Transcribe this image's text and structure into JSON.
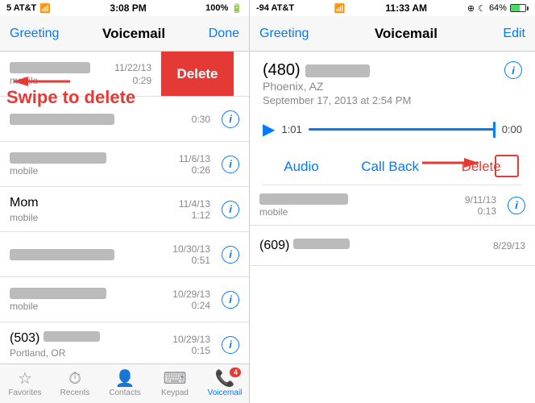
{
  "left": {
    "status": {
      "carrier": "5 AT&T",
      "signal": "▪▪▪▪▪",
      "wifi": "WiFi",
      "time": "3:08 PM",
      "battery_pct": "100%"
    },
    "nav": {
      "greeting": "Greeting",
      "title": "Voicemail",
      "done": "Done"
    },
    "swipe_label": "Swipe to delete",
    "delete_btn": "Delete",
    "items": [
      {
        "name": "blurred",
        "sub": "mobile",
        "date": "11/22/13",
        "dur": "0:29",
        "swiped": true
      },
      {
        "name": "blurred",
        "sub": "",
        "date": "",
        "dur": "0:30",
        "swiped": false
      },
      {
        "name": "blurred",
        "sub": "mobile",
        "date": "11/6/13",
        "dur": "0:26",
        "swiped": false
      },
      {
        "name": "Mom",
        "sub": "mobile",
        "date": "11/4/13",
        "dur": "1:12",
        "swiped": false
      },
      {
        "name": "blurred",
        "sub": "",
        "date": "10/30/13",
        "dur": "0:51",
        "swiped": false
      },
      {
        "name": "blurred",
        "sub": "mobile",
        "date": "10/29/13",
        "dur": "0:24",
        "swiped": false
      },
      {
        "name": "(503) blurred",
        "sub": "Portland, OR",
        "date": "10/29/13",
        "dur": "0:15",
        "swiped": false
      }
    ],
    "tabs": [
      {
        "icon": "★",
        "label": "Favorites",
        "badge": null,
        "active": false
      },
      {
        "icon": "⏱",
        "label": "Recents",
        "badge": null,
        "active": false
      },
      {
        "icon": "👤",
        "label": "Contacts",
        "badge": null,
        "active": false
      },
      {
        "icon": "⌨",
        "label": "Keypad",
        "badge": null,
        "active": false
      },
      {
        "icon": "📞",
        "label": "Voicemail",
        "badge": "4",
        "active": true
      }
    ]
  },
  "right": {
    "status": {
      "carrier": "-94 AT&T",
      "wifi": "WiFi",
      "time": "11:33 AM",
      "icons": "⊕ ☾",
      "battery_pct": "64%"
    },
    "nav": {
      "greeting": "Greeting",
      "title": "Voicemail",
      "edit": "Edit"
    },
    "detail": {
      "number": "(480)",
      "number_blurred": true,
      "location": "Phoenix, AZ",
      "date": "September 17, 2013 at 2:54 PM",
      "scrubber_pos": "1:01",
      "scrubber_end": "0:00"
    },
    "actions": {
      "audio": "Audio",
      "callback": "Call Back",
      "delete": "Delete"
    },
    "bottom_items": [
      {
        "sub": "mobile",
        "date": "9/11/13",
        "dur": "0:13"
      },
      {
        "name": "(609)",
        "date": "8/29/13",
        "dur": ""
      }
    ]
  }
}
